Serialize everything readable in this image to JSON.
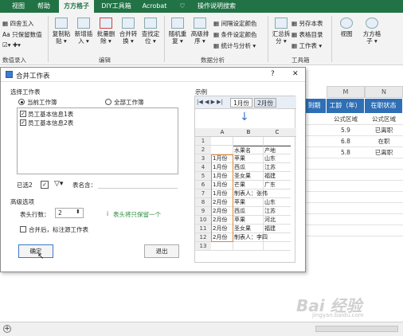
{
  "ribbon": {
    "tabs": [
      "视图",
      "帮助",
      "方方格子",
      "DIY工具箱",
      "Acrobat",
      "操作说明搜索"
    ],
    "tell_icon": "lightbulb-icon",
    "left_items": [
      "四舍五入",
      "只保留数值"
    ],
    "left_group": "数值录入",
    "buttons": [
      {
        "label": "复制粘\n贴 ▾"
      },
      {
        "label": "新增插\n入 ▾"
      },
      {
        "label": "批量删\n除 ▾"
      },
      {
        "label": "合并转\n换 ▾"
      },
      {
        "label": "查找定\n位 ▾"
      },
      {
        "label": "随机重\n复 ▾"
      },
      {
        "label": "高级排\n序 ▾"
      },
      {
        "label": "汇总拆\n分 ▾"
      },
      {
        "label": "视图"
      },
      {
        "label": "方方格\n子 ▾"
      }
    ],
    "group_edit": "编辑",
    "group_data": "数据分析",
    "group_tool": "工具箱",
    "data_small": [
      "间隔设定颜色",
      "条件设定颜色",
      "统计与分析 ▾"
    ],
    "tool_small": [
      "另存本表",
      "表格目录",
      "工作表 ▾"
    ]
  },
  "sheet": {
    "columns": [
      "M",
      "N"
    ],
    "headers": [
      "到期",
      "工龄（年）",
      "在职状态"
    ],
    "rows": [
      [
        "公式区域",
        "公式区域"
      ],
      [
        "5.9",
        "已离职"
      ],
      [
        "6.8",
        "在职"
      ],
      [
        "5.8",
        "已离职"
      ]
    ]
  },
  "dialog": {
    "title": "合并工作表",
    "help": "?",
    "close": "✕",
    "select_label": "选择工作表",
    "radio_current": "当前工作簿",
    "radio_all": "全部工作簿",
    "sheets": [
      "员工基本信息1表",
      "员工基本信息2表"
    ],
    "selected_count": "已选2",
    "filter_icon": "filter-icon",
    "sheet_name_label": "表名含：",
    "adv_label": "高级选项",
    "header_rows_label": "表头行数：",
    "header_rows_value": "2",
    "info_icon": "info-icon",
    "hint": "表头将只保留一个",
    "mark_label": "合并后，标注源工作表",
    "ok": "确定",
    "exit": "退出",
    "example_label": "示例",
    "example_tabs": [
      "1月份",
      "2月份"
    ],
    "example_cols": [
      "A",
      "B",
      "C"
    ],
    "example_header": [
      "水果名",
      "产地"
    ],
    "example_rows": [
      [
        "1月份",
        "苹果",
        "山东"
      ],
      [
        "1月份",
        "西瓜",
        "江苏"
      ],
      [
        "1月份",
        "圣女果",
        "福建"
      ],
      [
        "1月份",
        "芒果",
        "广东"
      ],
      [
        "1月份",
        "制表人：张伟",
        ""
      ],
      [
        "2月份",
        "苹果",
        "山东"
      ],
      [
        "2月份",
        "西瓜",
        "江苏"
      ],
      [
        "2月份",
        "苹果",
        "河北"
      ],
      [
        "2月份",
        "圣女果",
        "福建"
      ],
      [
        "2月份",
        "制表人：李四",
        ""
      ]
    ]
  },
  "watermark": "Bai 经验",
  "watermark_sub": "jingyan.baidu.com"
}
